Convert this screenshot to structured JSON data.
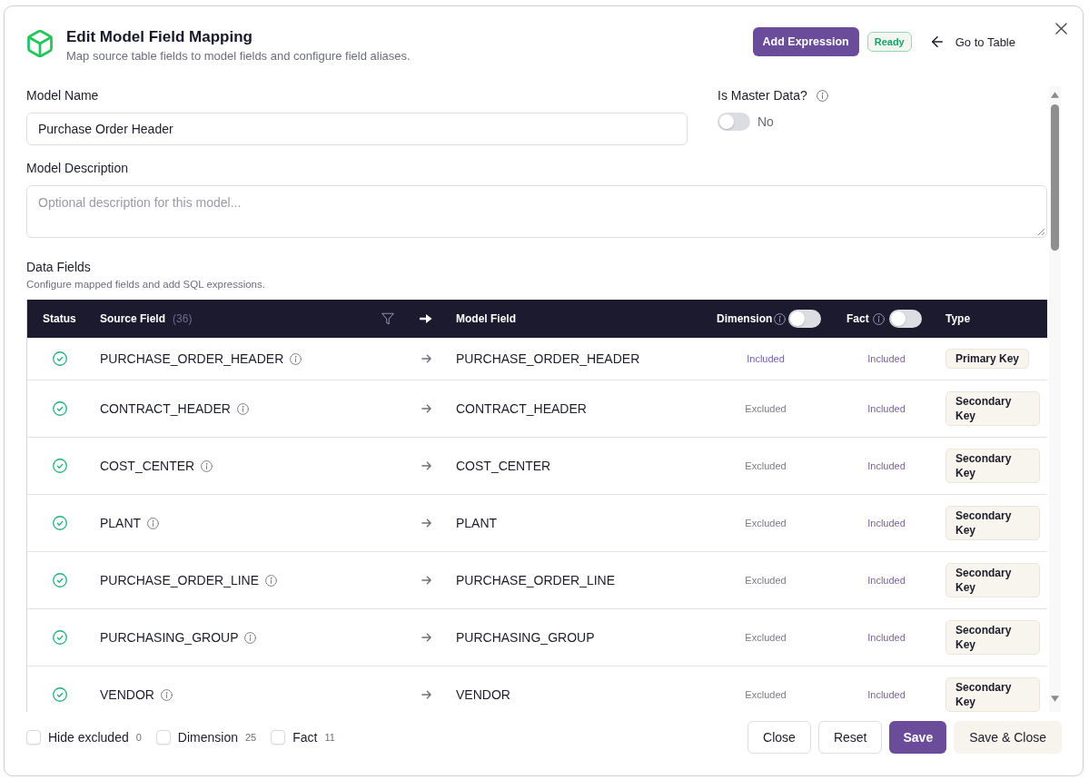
{
  "dialog": {
    "title": "Edit Model Field Mapping",
    "subtitle": "Map source table fields to model fields and configure field aliases."
  },
  "header_actions": {
    "add_expression": "Add Expression",
    "status_badge": "Ready",
    "go_to_table": "Go to Table"
  },
  "form": {
    "model_name": {
      "label": "Model Name",
      "value": "Purchase Order Header"
    },
    "master_data": {
      "label": "Is Master Data?",
      "on": false,
      "state_text": "No"
    },
    "model_description": {
      "label": "Model Description",
      "placeholder": "Optional description for this model..."
    }
  },
  "data_fields": {
    "title": "Data Fields",
    "subtitle": "Configure mapped fields and add SQL expressions.",
    "columns": {
      "status": "Status",
      "source_field": {
        "label": "Source Field",
        "count": "(36)"
      },
      "model_field": "Model Field",
      "dimension": {
        "label": "Dimension",
        "on": false
      },
      "fact": {
        "label": "Fact",
        "on": false
      },
      "type": "Type"
    },
    "rows": [
      {
        "mapped": true,
        "source": "PURCHASE_ORDER_HEADER",
        "target": "PURCHASE_ORDER_HEADER",
        "dimension": {
          "text": "Included",
          "included": true
        },
        "fact": {
          "text": "Included",
          "included": true
        },
        "type": "Primary Key"
      },
      {
        "mapped": true,
        "source": "CONTRACT_HEADER",
        "target": "CONTRACT_HEADER",
        "dimension": {
          "text": "Excluded",
          "included": false
        },
        "fact": {
          "text": "Included",
          "included": true
        },
        "type": "Secondary Key"
      },
      {
        "mapped": true,
        "source": "COST_CENTER",
        "target": "COST_CENTER",
        "dimension": {
          "text": "Excluded",
          "included": false
        },
        "fact": {
          "text": "Included",
          "included": true
        },
        "type": "Secondary Key"
      },
      {
        "mapped": true,
        "source": "PLANT",
        "target": "PLANT",
        "dimension": {
          "text": "Excluded",
          "included": false
        },
        "fact": {
          "text": "Included",
          "included": true
        },
        "type": "Secondary Key"
      },
      {
        "mapped": true,
        "source": "PURCHASE_ORDER_LINE",
        "target": "PURCHASE_ORDER_LINE",
        "dimension": {
          "text": "Excluded",
          "included": false
        },
        "fact": {
          "text": "Included",
          "included": true
        },
        "type": "Secondary Key"
      },
      {
        "mapped": true,
        "source": "PURCHASING_GROUP",
        "target": "PURCHASING_GROUP",
        "dimension": {
          "text": "Excluded",
          "included": false
        },
        "fact": {
          "text": "Included",
          "included": true
        },
        "type": "Secondary Key"
      },
      {
        "mapped": true,
        "source": "VENDOR",
        "target": "VENDOR",
        "dimension": {
          "text": "Excluded",
          "included": false
        },
        "fact": {
          "text": "Included",
          "included": true
        },
        "type": "Secondary Key"
      }
    ]
  },
  "footer": {
    "filters": [
      {
        "label": "Hide excluded",
        "count": "0",
        "checked": false
      },
      {
        "label": "Dimension",
        "count": "25",
        "checked": false
      },
      {
        "label": "Fact",
        "count": "11",
        "checked": false
      }
    ],
    "buttons": [
      {
        "label": "Close",
        "kind": "outline"
      },
      {
        "label": "Reset",
        "kind": "outline"
      },
      {
        "label": "Save",
        "kind": "primary"
      },
      {
        "label": "Save & Close",
        "kind": "soft"
      }
    ]
  }
}
